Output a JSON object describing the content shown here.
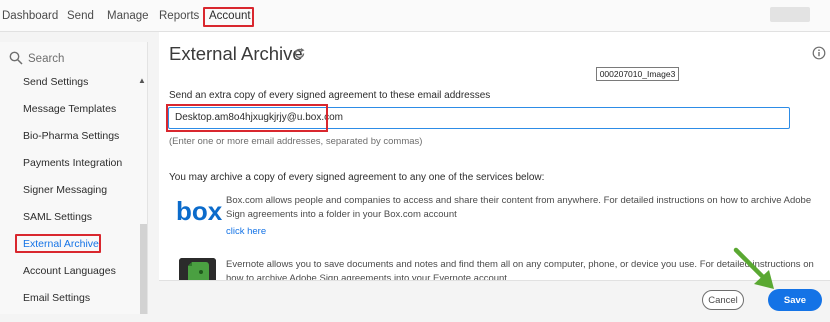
{
  "topnav": {
    "tabs": [
      {
        "label": "Dashboard"
      },
      {
        "label": "Send"
      },
      {
        "label": "Manage"
      },
      {
        "label": "Reports"
      },
      {
        "label": "Account"
      }
    ]
  },
  "sidebar": {
    "search_placeholder": "Search",
    "items": [
      {
        "label": "Send Settings"
      },
      {
        "label": "Message Templates"
      },
      {
        "label": "Bio-Pharma Settings"
      },
      {
        "label": "Payments Integration"
      },
      {
        "label": "Signer Messaging"
      },
      {
        "label": "SAML Settings"
      },
      {
        "label": "External Archive"
      },
      {
        "label": "Account Languages"
      },
      {
        "label": "Email Settings"
      }
    ],
    "selected": "External Archive"
  },
  "main": {
    "title": "External Archive",
    "image_label": "000207010_Image3",
    "email_label": "Send an extra copy of every signed agreement to these email addresses",
    "email_value": "Desktop.am8o4hjxugkjrjy@u.box.com",
    "email_hint": "(Enter one or more email addresses, separated by commas)",
    "services_label": "You may archive a copy of every signed agreement to any one of the services below:",
    "box": {
      "logo_text": "box",
      "description": "Box.com allows people and companies to access and share their content from anywhere. For detailed instructions on how to archive Adobe Sign agreements into a folder in your Box.com account",
      "link": "click here"
    },
    "evernote": {
      "description": "Evernote allows you to save documents and notes and find them all on any computer, phone, or device you use. For detailed instructions on how to archive Adobe Sign agreements into your Evernote account"
    }
  },
  "footer": {
    "cancel_label": "Cancel",
    "save_label": "Save"
  },
  "colors": {
    "accent": "#1473e6",
    "highlight": "#d9272e",
    "arrow": "#5aa832"
  }
}
